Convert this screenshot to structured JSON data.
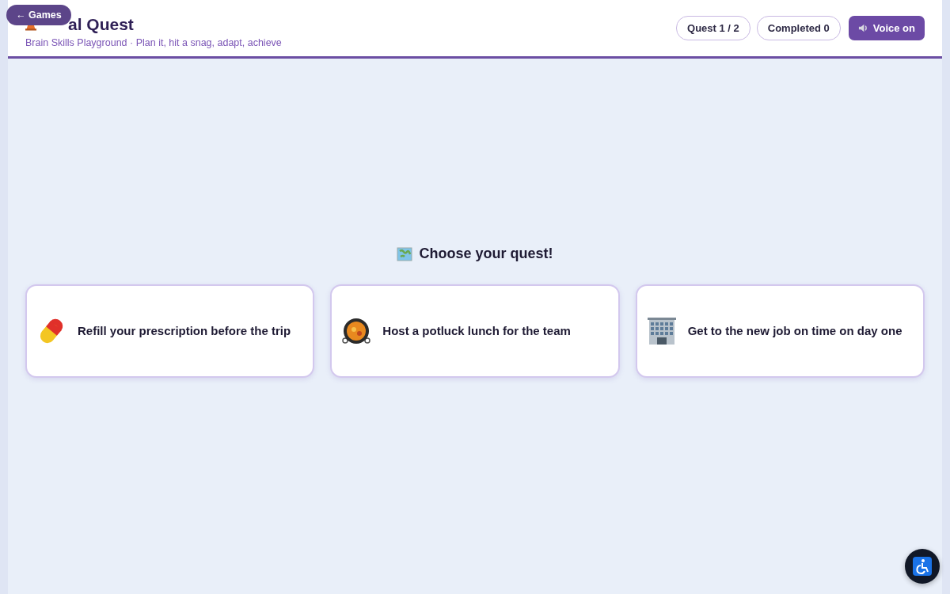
{
  "back_button": {
    "label": "← Games"
  },
  "header": {
    "title": "al Quest",
    "subtitle": "Brain Skills Playground · Plan it, hit a snag, adapt, achieve"
  },
  "badges": [
    {
      "label": "Quest 1 / 2"
    },
    {
      "label": "Completed 0"
    }
  ],
  "voice_button": {
    "label": "Voice on"
  },
  "prompt": "Choose your quest!",
  "quests": [
    {
      "kind": "pill",
      "label": "Refill your prescription before the trip"
    },
    {
      "kind": "pan",
      "label": "Host a potluck lunch for the team"
    },
    {
      "kind": "building",
      "label": "Get to the new job on time on day one"
    }
  ]
}
